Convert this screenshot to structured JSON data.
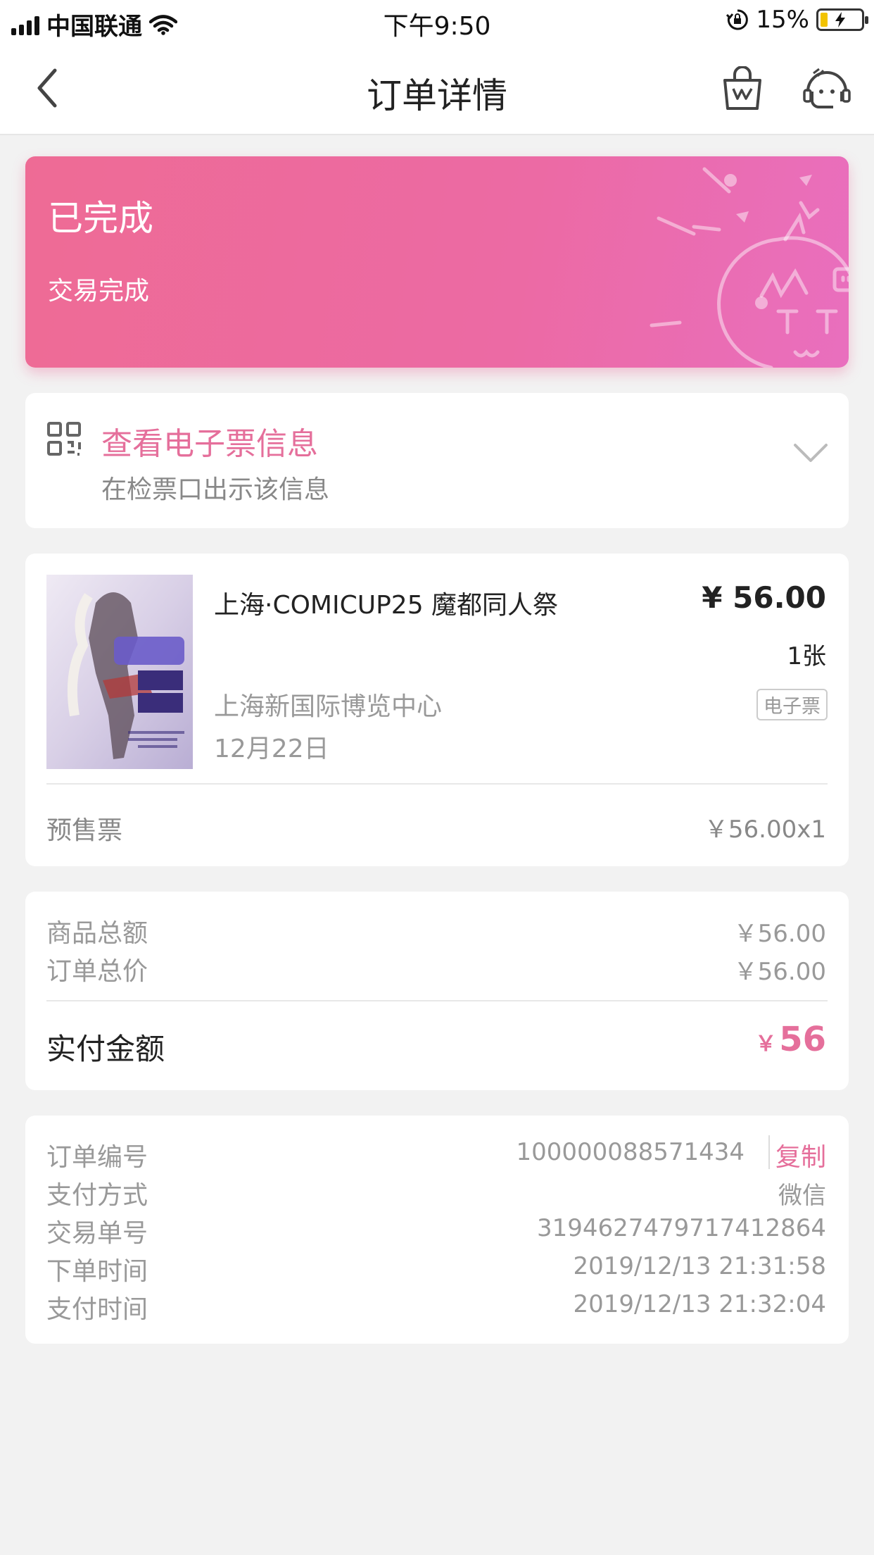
{
  "status_bar": {
    "carrier": "中国联通",
    "time": "下午9:50",
    "battery_pct": "15%"
  },
  "nav": {
    "title": "订单详情"
  },
  "status": {
    "title": "已完成",
    "subtitle": "交易完成"
  },
  "eticket": {
    "title": "查看电子票信息",
    "subtitle": "在检票口出示该信息"
  },
  "item": {
    "name": "上海·COMICUP25 魔都同人祭",
    "price": "¥ 56.00",
    "quantity": "1张",
    "venue": "上海新国际博览中心",
    "tag": "电子票",
    "date": "12月22日",
    "ticket_type": "预售票",
    "ticket_price": "￥56.00x1"
  },
  "totals": {
    "goods_label": "商品总额",
    "goods_value": "￥56.00",
    "order_label": "订单总价",
    "order_value": "￥56.00",
    "paid_label": "实付金额",
    "paid_currency": "￥",
    "paid_amount": "56"
  },
  "info": {
    "order_no_label": "订单编号",
    "order_no": "100000088571434",
    "copy_label": "复制",
    "pay_method_label": "支付方式",
    "pay_method": "微信",
    "trade_no_label": "交易单号",
    "trade_no": "3194627479717412864",
    "order_time_label": "下单时间",
    "order_time": "2019/12/13 21:31:58",
    "pay_time_label": "支付时间",
    "pay_time": "2019/12/13 21:32:04"
  },
  "colors": {
    "accent": "#e56f9b",
    "status_gradient_start": "#ee6b95",
    "status_gradient_end": "#e96fbe"
  },
  "icons": [
    "signal-icon",
    "wifi-icon",
    "orientation-lock-icon",
    "battery-icon",
    "back-icon",
    "shopping-bag-icon",
    "customer-service-icon",
    "qr-code-icon",
    "chevron-down-icon"
  ]
}
